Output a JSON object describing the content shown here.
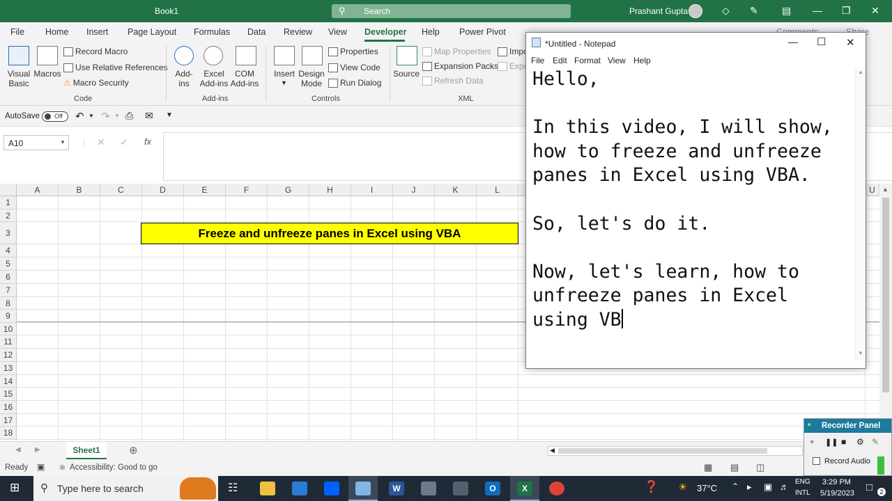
{
  "app": {
    "title": "Book1",
    "search_placeholder": "Search",
    "user": "Prashant Gupta"
  },
  "tabs": [
    "File",
    "Home",
    "Insert",
    "Page Layout",
    "Formulas",
    "Data",
    "Review",
    "View",
    "Developer",
    "Help",
    "Power Pivot"
  ],
  "active_tab": "Developer",
  "tab_right": {
    "comments": "Comments",
    "share": "Share"
  },
  "ribbon": {
    "code": {
      "group": "Code",
      "visual_basic": [
        "Visual",
        "Basic"
      ],
      "macros": "Macros",
      "record_macro": "Record Macro",
      "relative_refs": "Use Relative References",
      "macro_security": "Macro Security"
    },
    "addins": {
      "group": "Add-ins",
      "addins": [
        "Add-",
        "ins"
      ],
      "excel_addins": [
        "Excel",
        "Add-ins"
      ],
      "com_addins": [
        "COM",
        "Add-ins"
      ]
    },
    "controls": {
      "group": "Controls",
      "insert": "Insert",
      "design_mode": [
        "Design",
        "Mode"
      ],
      "properties": "Properties",
      "view_code": "View Code",
      "run_dialog": "Run Dialog"
    },
    "xml": {
      "group": "XML",
      "source": "Source",
      "map_properties": "Map Properties",
      "expansion_packs": "Expansion Packs",
      "refresh_data": "Refresh Data",
      "import": "Impo",
      "export": "Expo"
    }
  },
  "qat": {
    "autosave": "AutoSave",
    "toggle": "Off"
  },
  "namebox": "A10",
  "columns": [
    "A",
    "B",
    "C",
    "D",
    "E",
    "F",
    "G",
    "H",
    "I",
    "J",
    "K",
    "L",
    "U"
  ],
  "rows": [
    "1",
    "2",
    "3",
    "4",
    "5",
    "6",
    "7",
    "8",
    "9",
    "10",
    "11",
    "12",
    "13",
    "14",
    "15",
    "16",
    "17",
    "18"
  ],
  "cell_title": "Freeze and unfreeze panes in Excel using VBA",
  "sheet_tab": "Sheet1",
  "status": {
    "ready": "Ready",
    "accessibility": "Accessibility: Good to go"
  },
  "notepad": {
    "title": "*Untitled - Notepad",
    "menu": [
      "File",
      "Edit",
      "Format",
      "View",
      "Help"
    ],
    "lines": [
      "Hello,",
      "",
      "In this video, I will show,",
      "how to freeze and unfreeze",
      "panes in Excel using VBA.",
      "",
      "So, let's do it.",
      "",
      "Now, let's learn, how to",
      "unfreeze panes in Excel",
      "using VB"
    ]
  },
  "recorder": {
    "title": "Recorder Panel",
    "record_audio": "Record Audio"
  },
  "taskbar": {
    "search_placeholder": "Type here to search",
    "weather": "37°C",
    "lang1": "ENG",
    "lang2": "INTL",
    "time": "3:29 PM",
    "date": "5/19/2023",
    "notif_count": "2"
  },
  "colors": {
    "excel_green": "#217346",
    "title_highlight": "#ffff00",
    "taskbar": "#1f2a36"
  }
}
